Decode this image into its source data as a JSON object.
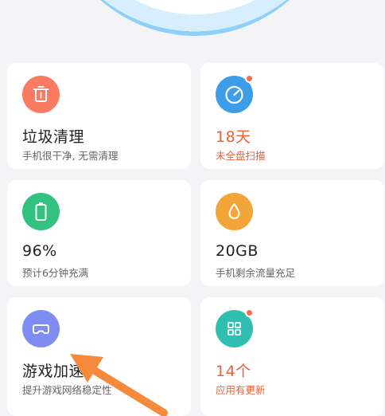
{
  "cards": [
    {
      "title": "垃圾清理",
      "subtitle": "手机很干净, 无需清理",
      "icon": "trash-icon",
      "color": "#fb7a62"
    },
    {
      "title": "18天",
      "subtitle": "未全盘扫描",
      "icon": "speedometer-icon",
      "color": "#3d9de9",
      "badge": true
    },
    {
      "title": "96%",
      "subtitle": "预计6分钟充满",
      "icon": "battery-icon",
      "color": "#32c17e"
    },
    {
      "title": "20GB",
      "subtitle": "手机剩余流量充足",
      "icon": "droplet-icon",
      "color": "#f4a53a"
    },
    {
      "title": "游戏加速",
      "subtitle": "提升游戏网络稳定性",
      "icon": "gamepad-icon",
      "color": "#7f8cf2"
    },
    {
      "title": "14个",
      "subtitle": "应用有更新",
      "icon": "apps-grid-icon",
      "color": "#2fbfb0",
      "badge": true
    }
  ],
  "colors": {
    "warning_text": "#e8613b",
    "arrow": "#f58a3c"
  }
}
